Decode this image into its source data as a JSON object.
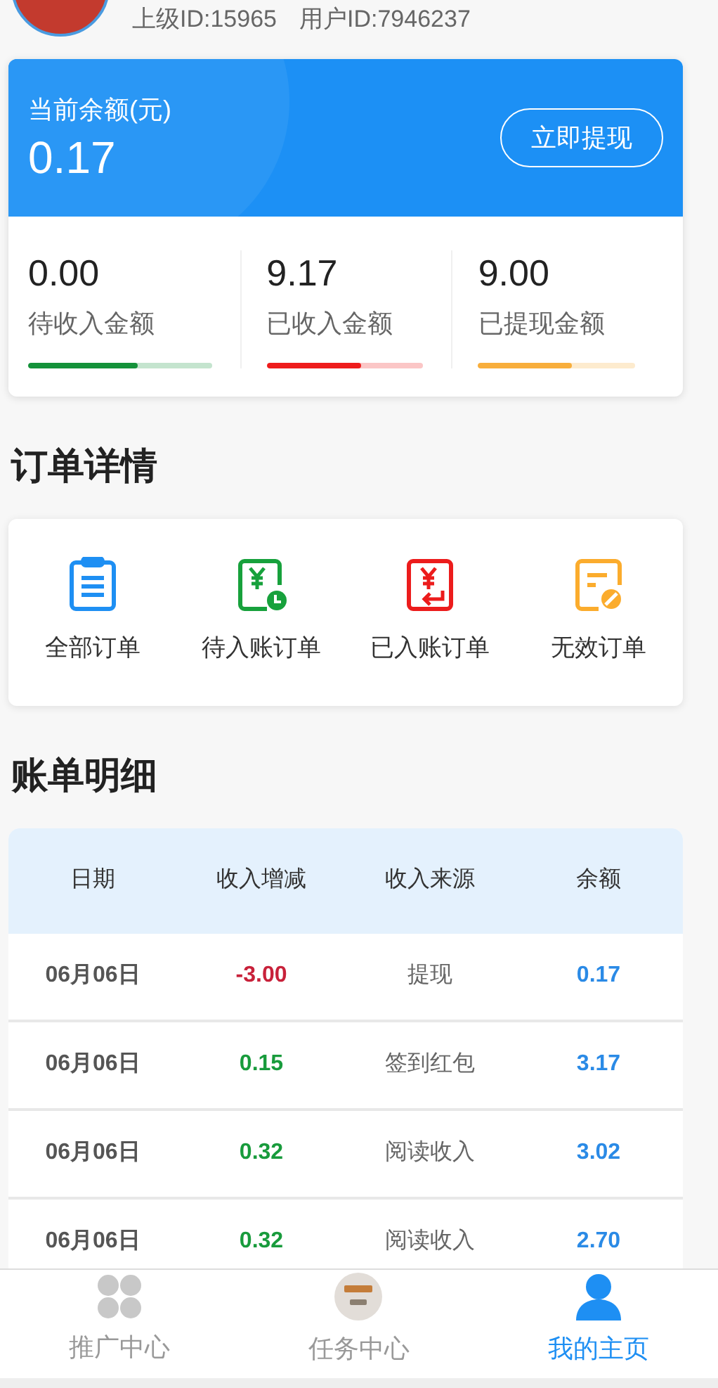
{
  "profile": {
    "parent_id": "上级ID:15965",
    "user_id": "用户ID:7946237"
  },
  "balance": {
    "label": "当前余额(元)",
    "amount": "0.17",
    "button": "立即提现",
    "stats": [
      {
        "value": "0.00",
        "label": "待收入金额",
        "level": 0.6,
        "color": "#14923a"
      },
      {
        "value": "9.17",
        "label": "已收入金额",
        "level": 0.6,
        "color": "#ee1c1c"
      },
      {
        "value": "9.00",
        "label": "已提现金额",
        "level": 0.6,
        "color": "#f8ae3c"
      }
    ]
  },
  "orders": {
    "title": "订单详情",
    "items": [
      {
        "kind": "all",
        "label": "全部订单",
        "color": "#1e8ff3"
      },
      {
        "kind": "pending",
        "label": "待入账订单",
        "color": "#17a13c"
      },
      {
        "kind": "received",
        "label": "已入账订单",
        "color": "#ec1c1c"
      },
      {
        "kind": "invalid",
        "label": "无效订单",
        "color": "#fbac2d"
      }
    ]
  },
  "bills": {
    "title": "账单明细",
    "columns": [
      "日期",
      "收入增减",
      "收入来源",
      "余额"
    ],
    "rows": [
      {
        "date": "06月06日",
        "change": "-3.00",
        "kind": "expense",
        "source": "提现",
        "balance": "0.17"
      },
      {
        "date": "06月06日",
        "change": "0.15",
        "kind": "income",
        "source": "签到红包",
        "balance": "3.17"
      },
      {
        "date": "06月06日",
        "change": "0.32",
        "kind": "income",
        "source": "阅读收入",
        "balance": "3.02"
      },
      {
        "date": "06月06日",
        "change": "0.32",
        "kind": "income",
        "source": "阅读收入",
        "balance": "2.70"
      }
    ]
  },
  "tabbar": [
    {
      "kind": "grid",
      "label": "推广中心",
      "selected": false
    },
    {
      "kind": "badge",
      "label": "任务中心",
      "selected": false
    },
    {
      "kind": "person",
      "label": "我的主页",
      "selected": true
    }
  ]
}
